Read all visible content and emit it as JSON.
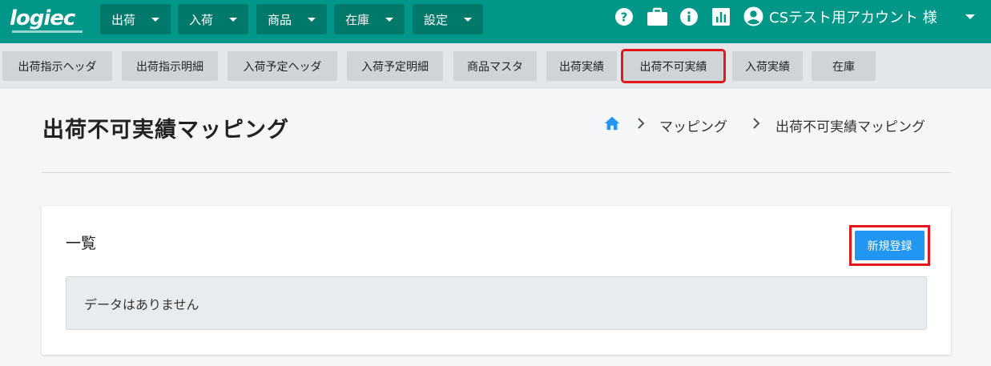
{
  "brand": {
    "logo_text": "logiec"
  },
  "top_menu": [
    {
      "label": "出荷"
    },
    {
      "label": "入荷"
    },
    {
      "label": "商品"
    },
    {
      "label": "在庫"
    },
    {
      "label": "設定"
    }
  ],
  "account": {
    "name": "CSテスト用アカウント 様"
  },
  "icons": [
    "help-icon",
    "briefcase-icon",
    "info-icon",
    "chart-icon",
    "account-circle-icon"
  ],
  "sub_menu": [
    {
      "label": "出荷指示ヘッダ"
    },
    {
      "label": "出荷指示明細"
    },
    {
      "label": "入荷予定ヘッダ"
    },
    {
      "label": "入荷予定明細"
    },
    {
      "label": "商品マスタ"
    },
    {
      "label": "出荷実績"
    },
    {
      "label": "出荷不可実績"
    },
    {
      "label": "入荷実績"
    },
    {
      "label": "在庫"
    }
  ],
  "page": {
    "title": "出荷不可実績マッピング",
    "breadcrumb": [
      "マッピング",
      "出荷不可実績マッピング"
    ]
  },
  "card": {
    "title": "一覧",
    "new_button": "新規登録",
    "empty_message": "データはありません"
  },
  "colors": {
    "topbar": "#009688",
    "menu_button": "#00796b",
    "primary": "#2196f3",
    "highlight": "#e5151c"
  }
}
